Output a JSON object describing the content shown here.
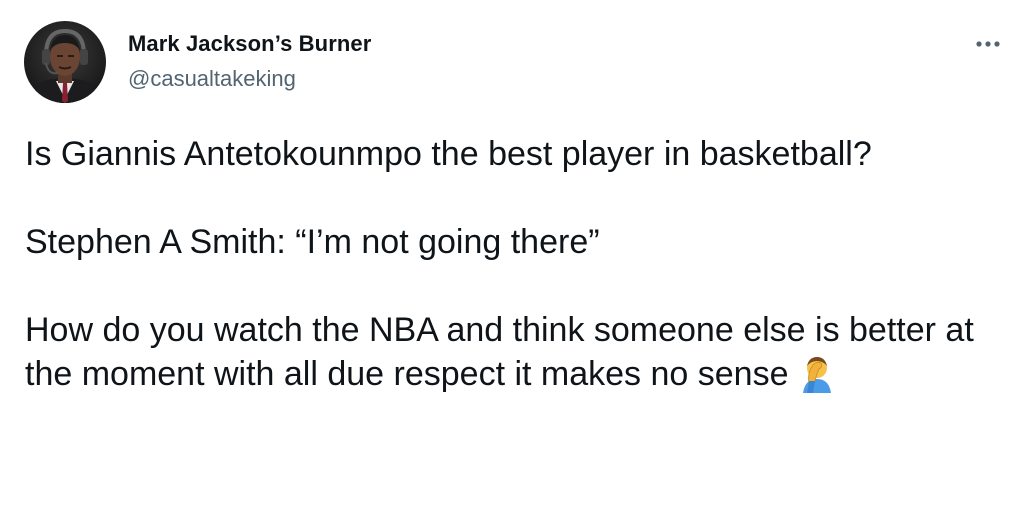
{
  "author": {
    "display_name": "Mark Jackson’s Burner",
    "handle": "@casualtakeking",
    "avatar_icon": "profile-photo"
  },
  "menu": {
    "icon": "more-horizontal-icon"
  },
  "tweet": {
    "paragraphs": [
      "Is Giannis Antetokounmpo the best player in basketball?",
      "Stephen A Smith: “I’m not going there”",
      "How do you watch the NBA and think someone else is better at the moment with all due respect it makes no sense"
    ],
    "trailing_emoji": "man-facepalming-emoji"
  },
  "colors": {
    "text": "#0f1419",
    "secondary": "#536471",
    "background": "#ffffff"
  }
}
